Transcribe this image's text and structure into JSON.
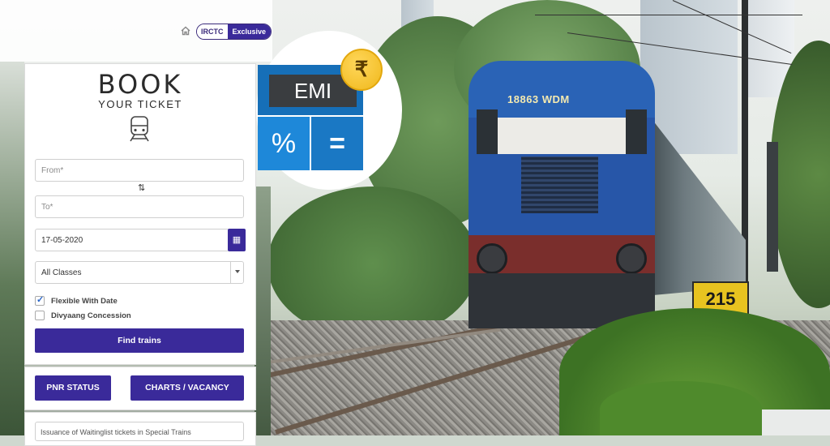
{
  "header": {
    "irctc_label": "IRCTC",
    "exclusive_label": "Exclusive"
  },
  "booking": {
    "title": "BOOK",
    "subtitle": "YOUR TICKET",
    "from_placeholder": "From*",
    "to_placeholder": "To*",
    "swap_symbol": "⇅",
    "date_value": "17-05-2020",
    "class_value": "All Classes",
    "flexible_label": "Flexible With Date",
    "flexible_checked": true,
    "divyaang_label": "Divyaang Concession",
    "divyaang_checked": false,
    "find_button": "Find trains"
  },
  "status": {
    "pnr_button": "PNR STATUS",
    "charts_button": "CHARTS / VACANCY"
  },
  "notice": {
    "text": "Issuance of Waitinglist tickets in Special Trains"
  },
  "emi_badge": {
    "screen_text": "EMI",
    "rupee_symbol": "₹",
    "key_percent": "%",
    "key_equals": "="
  },
  "photo": {
    "locomotive_number": "18863 WDM",
    "sign_text": "215"
  },
  "colors": {
    "primary": "#3a2a9a",
    "calculator_blue": "#1e88d9",
    "coin_gold": "#f0b81c"
  }
}
